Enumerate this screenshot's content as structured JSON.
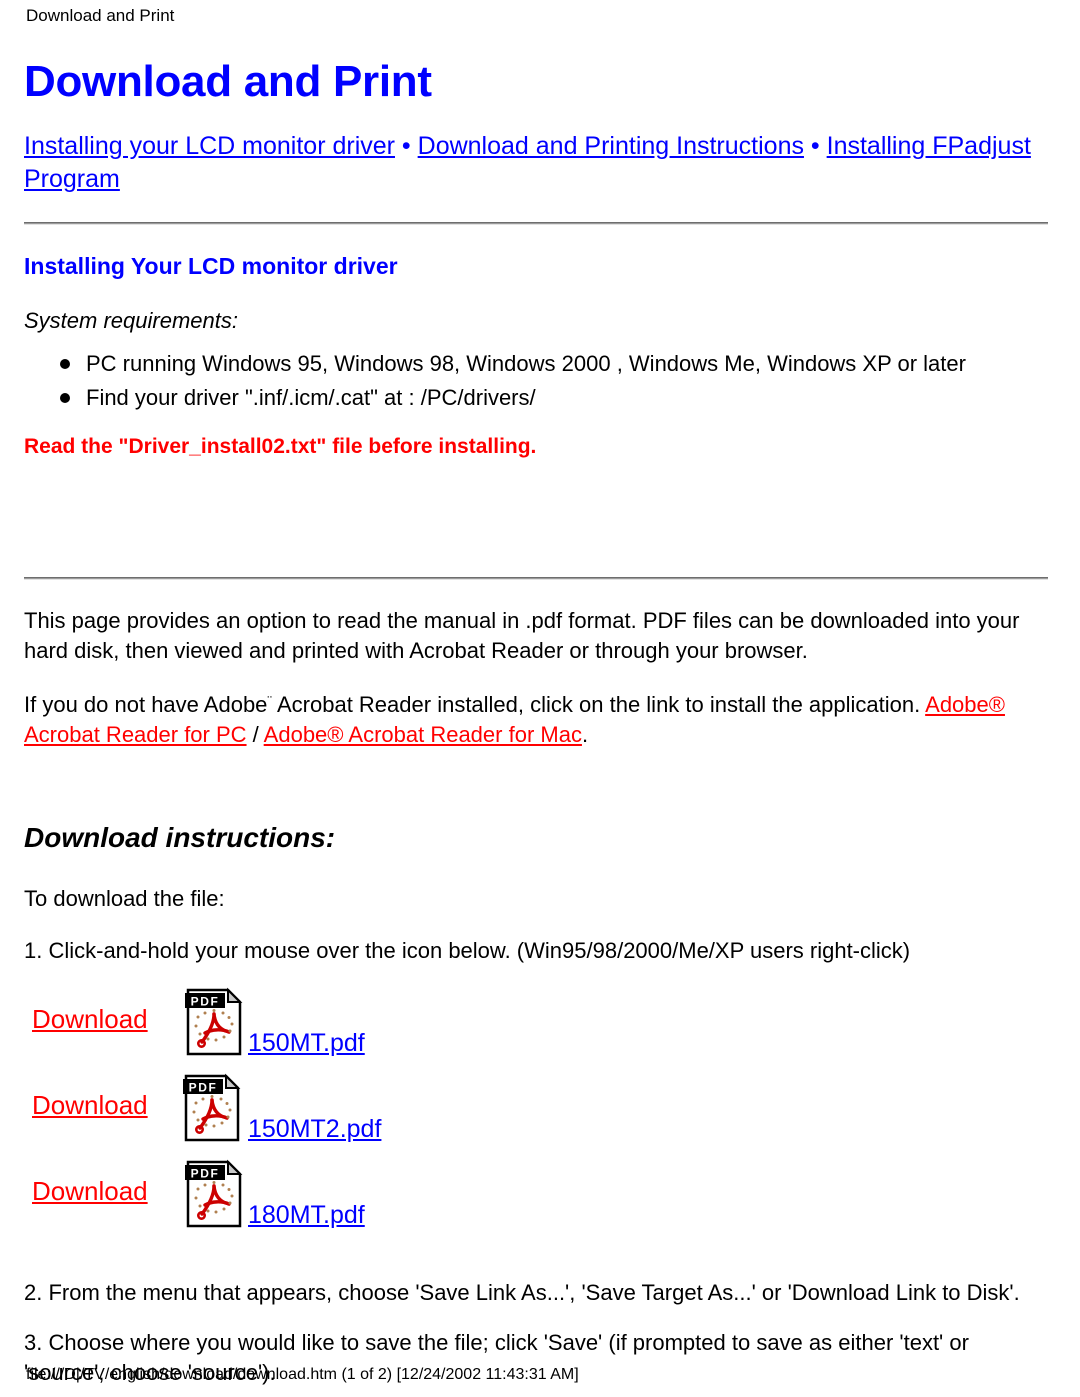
{
  "running_header": "Download and Print",
  "page_title": "Download and Print",
  "colors": {
    "link_blue": "#0000FF",
    "link_red": "#FF0000",
    "text_black": "#000000",
    "rule_gray": "#9A9A9A",
    "background": "#FFFFFF"
  },
  "nav": {
    "separator": " • ",
    "links": [
      {
        "label": "Installing your LCD monitor driver"
      },
      {
        "label": "Download and Printing Instructions"
      },
      {
        "label": "Installing FPadjust Program"
      }
    ]
  },
  "driver_section": {
    "heading": "Installing Your LCD monitor driver",
    "requirements_label": "System requirements:",
    "requirements": [
      "PC running Windows 95, Windows 98, Windows 2000 , Windows Me, Windows XP or later",
      "Find your driver \".inf/.icm/.cat\" at : /PC/drivers/"
    ],
    "warning": "Read the \"Driver_install02.txt\" file before installing."
  },
  "pdf_section": {
    "intro": "This page provides an option to read the manual in .pdf format. PDF files can be downloaded into your hard disk, then viewed and printed with Acrobat Reader or through your browser.",
    "acrobat_prefix": "If you do not have Adobe",
    "acrobat_tm": "¨",
    "acrobat_mid": " Acrobat Reader installed, click on the link to install the application. ",
    "acrobat_link_pc": "Adobe® Acrobat Reader for PC",
    "acrobat_link_divider": " / ",
    "acrobat_link_mac": "Adobe® Acrobat Reader for Mac",
    "acrobat_suffix": "."
  },
  "download_section": {
    "heading": "Download instructions:",
    "lead": "To download the file:",
    "step1": "1. Click-and-hold your mouse over the icon below. (Win95/98/2000/Me/XP users right-click)",
    "step2": "2. From the menu that appears, choose 'Save Link As...', 'Save Target As...' or 'Download Link to Disk'.",
    "step3": "3. Choose where you would like to save the file; click 'Save' (if prompted to save as either 'text' or 'source', choose 'source').",
    "rows": [
      {
        "action": "Download",
        "icon": "pdf-file-icon",
        "icon_label": "PDF",
        "file": "150MT.pdf"
      },
      {
        "action": "Download",
        "icon": "pdf-file-icon",
        "icon_label": "PDF",
        "file": "150MT2.pdf"
      },
      {
        "action": "Download",
        "icon": "pdf-file-icon",
        "icon_label": "PDF",
        "file": "180MT.pdf"
      }
    ]
  },
  "footer": "file:///D|/TV/english/download/download.htm (1 of 2) [12/24/2002 11:43:31 AM]"
}
